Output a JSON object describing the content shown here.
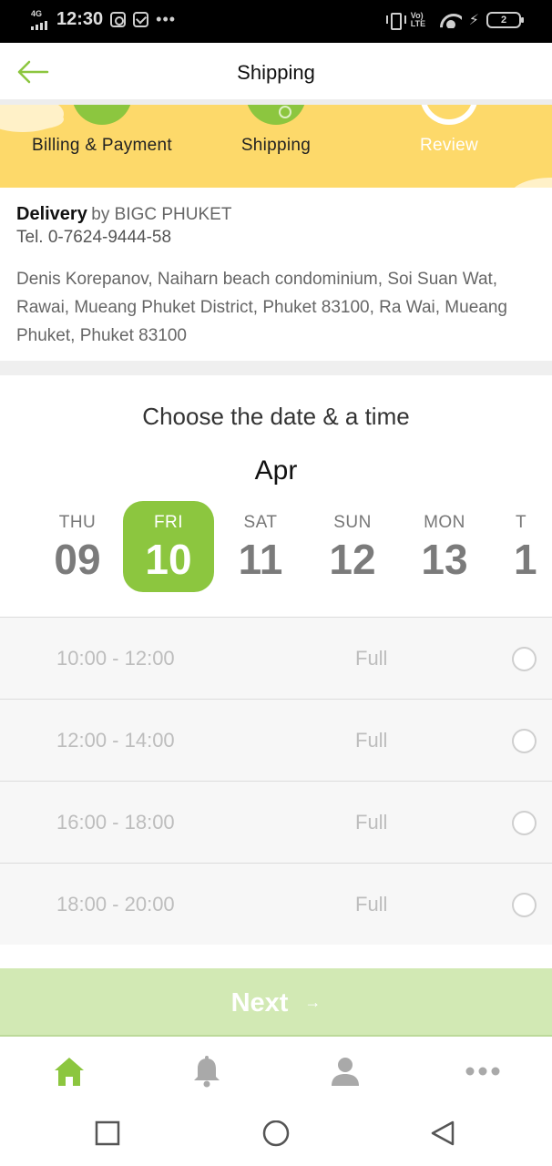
{
  "status_bar": {
    "network": "4G",
    "time": "12:30",
    "dots": "•••",
    "lte_top": "Vo)",
    "lte_bottom": "LTE",
    "battery": "2"
  },
  "header": {
    "title": "Shipping",
    "back_icon": "arrow-left-icon"
  },
  "stepper": {
    "steps": [
      {
        "label": "Billing & Payment",
        "state": "done"
      },
      {
        "label": "Shipping",
        "state": "current"
      },
      {
        "label": "Review",
        "state": "pending"
      }
    ]
  },
  "delivery": {
    "title": "Delivery",
    "by": "by BIGC PHUKET",
    "tel": "Tel. 0-7624-9444-58",
    "address": "Denis Korepanov, Naiharn beach condominium, Soi Suan Wat, Rawai, Mueang Phuket District, Phuket 83100, Ra Wai, Mueang Phuket, Phuket 83100"
  },
  "date_picker": {
    "title": "Choose the date & a time",
    "month": "Apr",
    "days": [
      {
        "dow": "THU",
        "num": "09"
      },
      {
        "dow": "FRI",
        "num": "10",
        "selected": true
      },
      {
        "dow": "SAT",
        "num": "11"
      },
      {
        "dow": "SUN",
        "num": "12"
      },
      {
        "dow": "MON",
        "num": "13"
      }
    ],
    "partial_day": {
      "dow": "T",
      "num": "1"
    }
  },
  "slots": [
    {
      "time": "10:00 - 12:00",
      "status": "Full"
    },
    {
      "time": "12:00 - 14:00",
      "status": "Full"
    },
    {
      "time": "16:00 - 18:00",
      "status": "Full"
    },
    {
      "time": "18:00 - 20:00",
      "status": "Full"
    }
  ],
  "next_button": {
    "label": "Next",
    "arrow": "→"
  },
  "bottom_nav": [
    "home-icon",
    "bell-icon",
    "user-icon",
    "more-icon"
  ],
  "colors": {
    "accent": "#8cc63f",
    "banner": "#fdd96a",
    "next_disabled": "#d2e9b4"
  }
}
